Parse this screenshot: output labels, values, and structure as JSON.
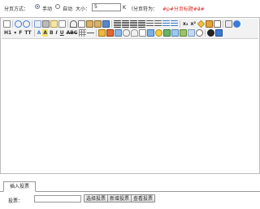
{
  "pager": {
    "label": "分页方式：",
    "manual_label": "手动",
    "auto_label": "自动",
    "size_label": "大小：",
    "size_value": "5",
    "size_unit": "K",
    "separator_label": "（分页符为：",
    "separator_value": "#p#分页标题#e#",
    "separator_close": "）",
    "mode": "manual"
  },
  "toolbar": {
    "row1_icons": [
      "source-icon",
      "undo-icon",
      "redo-icon",
      "preview-icon",
      "print-icon",
      "template-icon",
      "code-icon",
      "cut-icon",
      "copy-icon",
      "paste-icon",
      "paste-plain-icon",
      "paste-word-icon",
      "align-left-icon",
      "align-center-icon",
      "align-right-icon",
      "align-justify-icon",
      "ordered-list-icon",
      "unordered-list-icon",
      "indent-icon",
      "outdent-icon",
      "subscript-icon",
      "superscript-icon",
      "clear-format-icon",
      "select-all-icon",
      "fullscreen-icon",
      "anchor-icon",
      "help-icon"
    ],
    "row2": {
      "heading_label": "H1",
      "font_label": "F",
      "size_label": "TT",
      "font_color_label": "A",
      "bg_color_label": "A",
      "bold_label": "B",
      "italic_label": "I",
      "underline_label": "U",
      "strike_label": "ABC"
    },
    "accent": "#2a6fd6",
    "red": "#d22222"
  },
  "tabs": {
    "insert_vote": "插入投票"
  },
  "vote_row": {
    "label": "投票：",
    "select_button": "选择投票",
    "add_button": "新增投票",
    "view_button": "查看投票"
  }
}
